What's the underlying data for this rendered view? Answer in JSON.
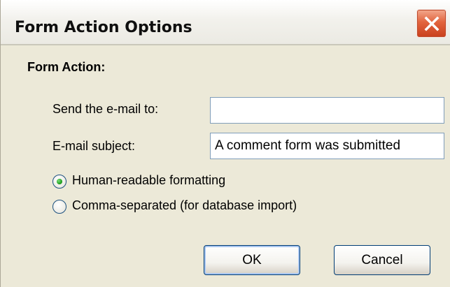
{
  "window": {
    "title": "Form Action Options"
  },
  "form": {
    "section_label": "Form Action:",
    "send_to_label": "Send the e-mail to:",
    "send_to_value": "",
    "subject_label": "E-mail subject:",
    "subject_value": "A comment form was submitted",
    "formatting_options": [
      {
        "label": "Human-readable formatting",
        "selected": true
      },
      {
        "label": "Comma-separated (for database import)",
        "selected": false
      }
    ]
  },
  "buttons": {
    "ok_label": "OK",
    "cancel_label": "Cancel"
  },
  "icons": {
    "close": "close-icon"
  },
  "colors": {
    "close_button": "#d9502a",
    "radio_selected": "#21a121",
    "input_border": "#7f9db9"
  }
}
